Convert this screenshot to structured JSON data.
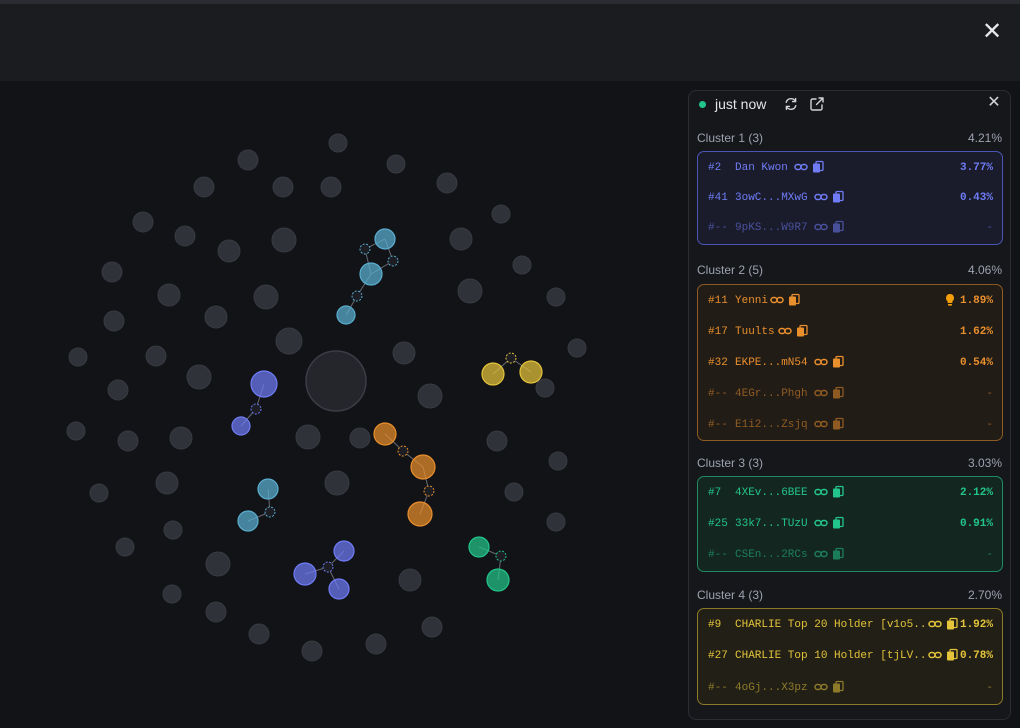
{
  "header": {
    "close_label": "✕"
  },
  "panel": {
    "time_label": "just now",
    "close_label": "✕",
    "clusters": [
      {
        "title": "Cluster 1 (3)",
        "pct": "4.21%",
        "color": "#6f7cf5",
        "rows": [
          {
            "rank": "#2",
            "name": "Dan Kwon",
            "pct": "3.77%"
          },
          {
            "rank": "#41",
            "name": "3owC...MXwG",
            "pct": "0.43%"
          },
          {
            "rank": "#--",
            "name": "9pKS...W9R7",
            "pct": "-"
          }
        ]
      },
      {
        "title": "Cluster 2 (5)",
        "pct": "4.06%",
        "color": "#e98f2c",
        "rows": [
          {
            "rank": "#11",
            "name": "Yenni",
            "pct": "1.89%"
          },
          {
            "rank": "#17",
            "name": "Tuults",
            "pct": "1.62%"
          },
          {
            "rank": "#32",
            "name": "EKPE...mN54",
            "pct": "0.54%"
          },
          {
            "rank": "#--",
            "name": "4EGr...Phgh",
            "pct": "-"
          },
          {
            "rank": "#--",
            "name": "E1i2...Zsjq",
            "pct": "-"
          }
        ]
      },
      {
        "title": "Cluster 3 (3)",
        "pct": "3.03%",
        "color": "#22c58b",
        "rows": [
          {
            "rank": "#7",
            "name": "4XEv...6BEE",
            "pct": "2.12%"
          },
          {
            "rank": "#25",
            "name": "33k7...TUzU",
            "pct": "0.91%"
          },
          {
            "rank": "#--",
            "name": "CSEn...2RCs",
            "pct": "-"
          }
        ]
      },
      {
        "title": "Cluster 4 (3)",
        "pct": "2.70%",
        "color": "#e4c43a",
        "rows": [
          {
            "rank": "#9",
            "name": "CHARLIE Top 20 Holder [v1o5...",
            "pct": "1.92%"
          },
          {
            "rank": "#27",
            "name": "CHARLIE Top 10 Holder [tjLV...",
            "pct": "0.78%"
          },
          {
            "rank": "#--",
            "name": "4oGj...X3pz",
            "pct": "-"
          }
        ]
      }
    ]
  },
  "colors": {
    "accent_green": "#22c58b",
    "node_gray": "#2f3238",
    "cluster_blue": "#6f7cf5",
    "cluster_cyan": "#5aaed0",
    "cluster_orange": "#e98f2c",
    "cluster_green": "#22c58b",
    "cluster_yellow": "#e4c43a"
  },
  "icons": {
    "link": "link-icon",
    "copy": "copy-icon",
    "refresh": "refresh-icon",
    "external": "external-link-icon",
    "insight": "lightbulb-icon"
  }
}
